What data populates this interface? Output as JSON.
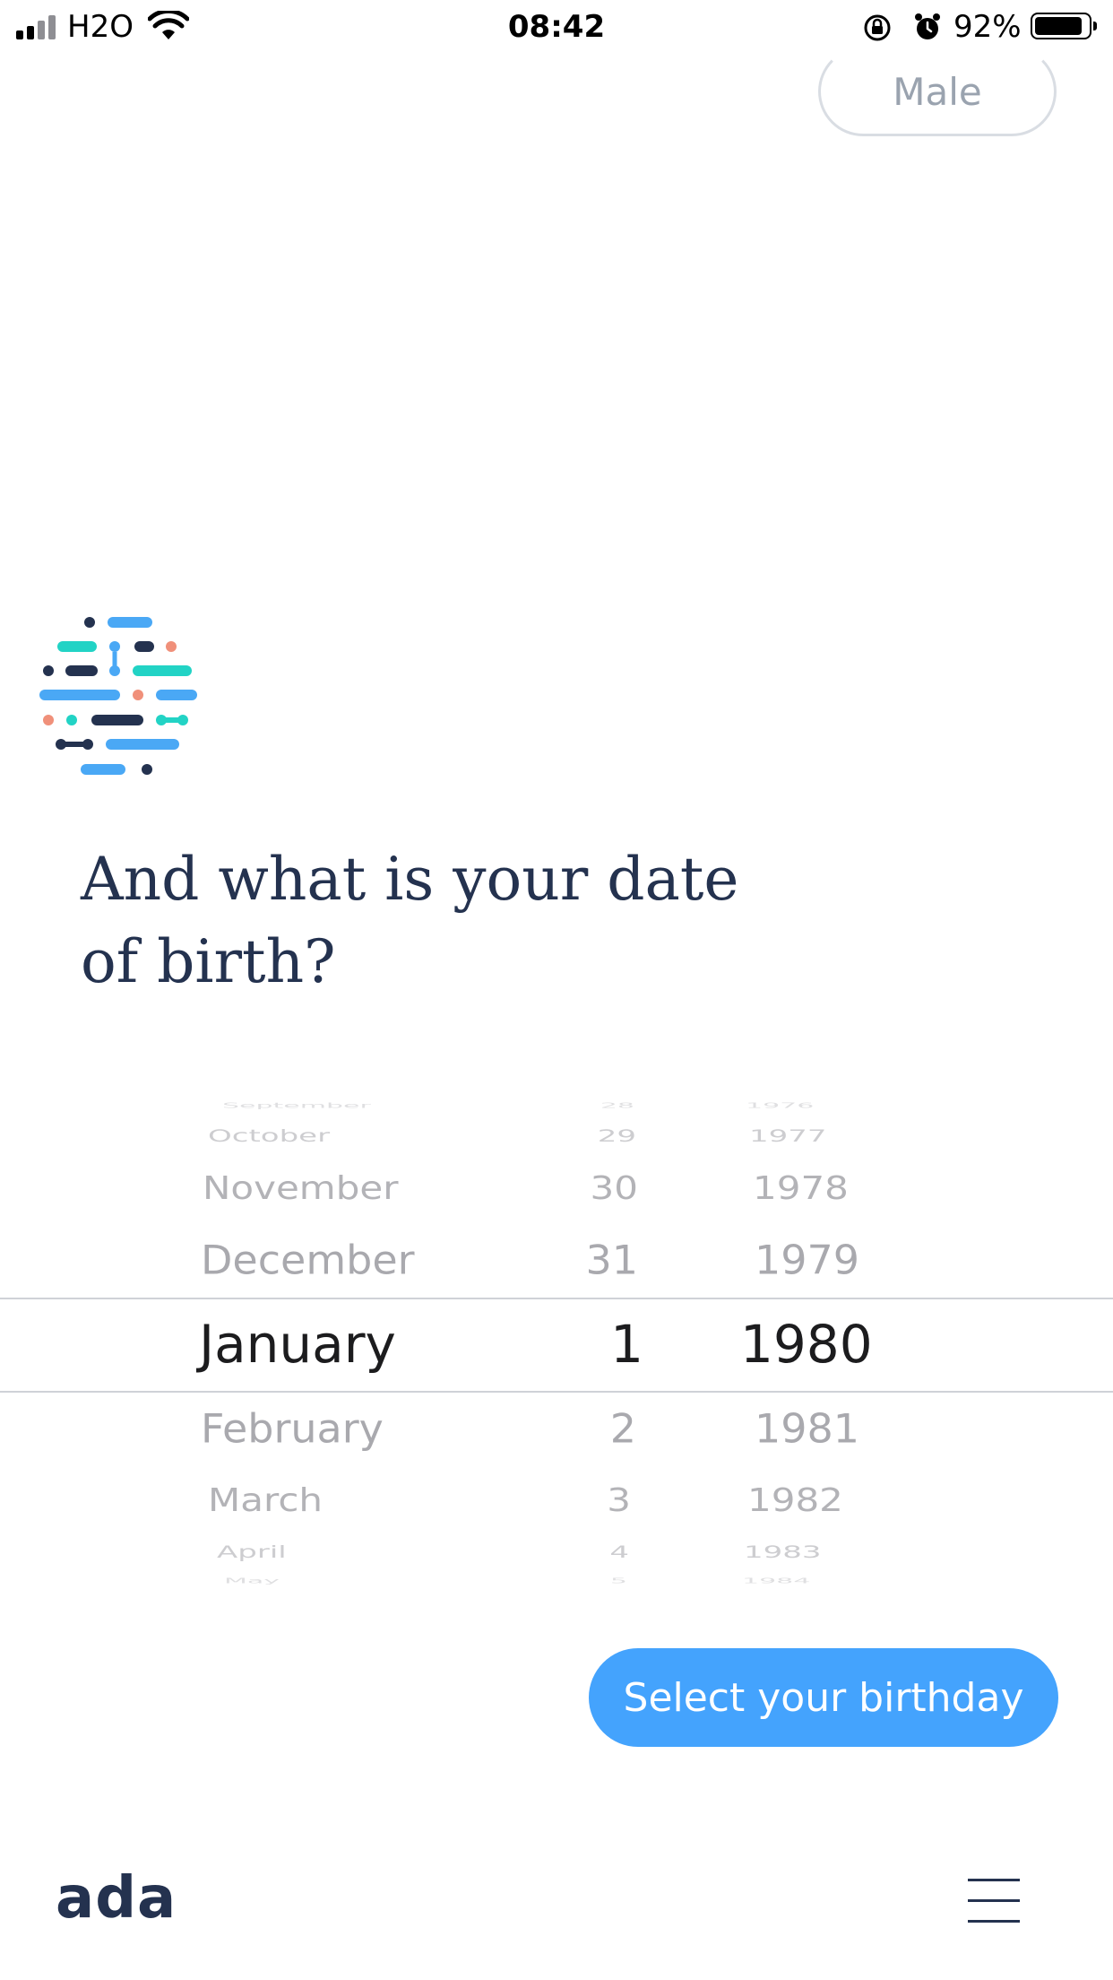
{
  "status_bar": {
    "carrier": "H2O",
    "time": "08:42",
    "battery_percent": "92%",
    "battery_level": 0.92,
    "icons": [
      "signal-icon",
      "wifi-icon",
      "orientation-lock-icon",
      "alarm-icon",
      "battery-icon"
    ]
  },
  "previous_answer": "Male",
  "question": {
    "line1": "And what is your date",
    "line2": "of birth?"
  },
  "picker": {
    "months": [
      "September",
      "October",
      "November",
      "December",
      "January",
      "February",
      "March",
      "April",
      "May"
    ],
    "days": [
      "28",
      "29",
      "30",
      "31",
      "1",
      "2",
      "3",
      "4",
      "5"
    ],
    "years": [
      "1976",
      "1977",
      "1978",
      "1979",
      "1980",
      "1981",
      "1982",
      "1983",
      "1984"
    ],
    "selected": {
      "month": "January",
      "day": "1",
      "year": "1980"
    }
  },
  "actions": {
    "select_label": "Select your birthday"
  },
  "brand": {
    "name": "ada"
  },
  "colors": {
    "primary": "#44a3fd",
    "navy": "#24324f",
    "teal": "#22d3c5",
    "coral": "#f0907a",
    "light_blue": "#4aa8f5"
  }
}
